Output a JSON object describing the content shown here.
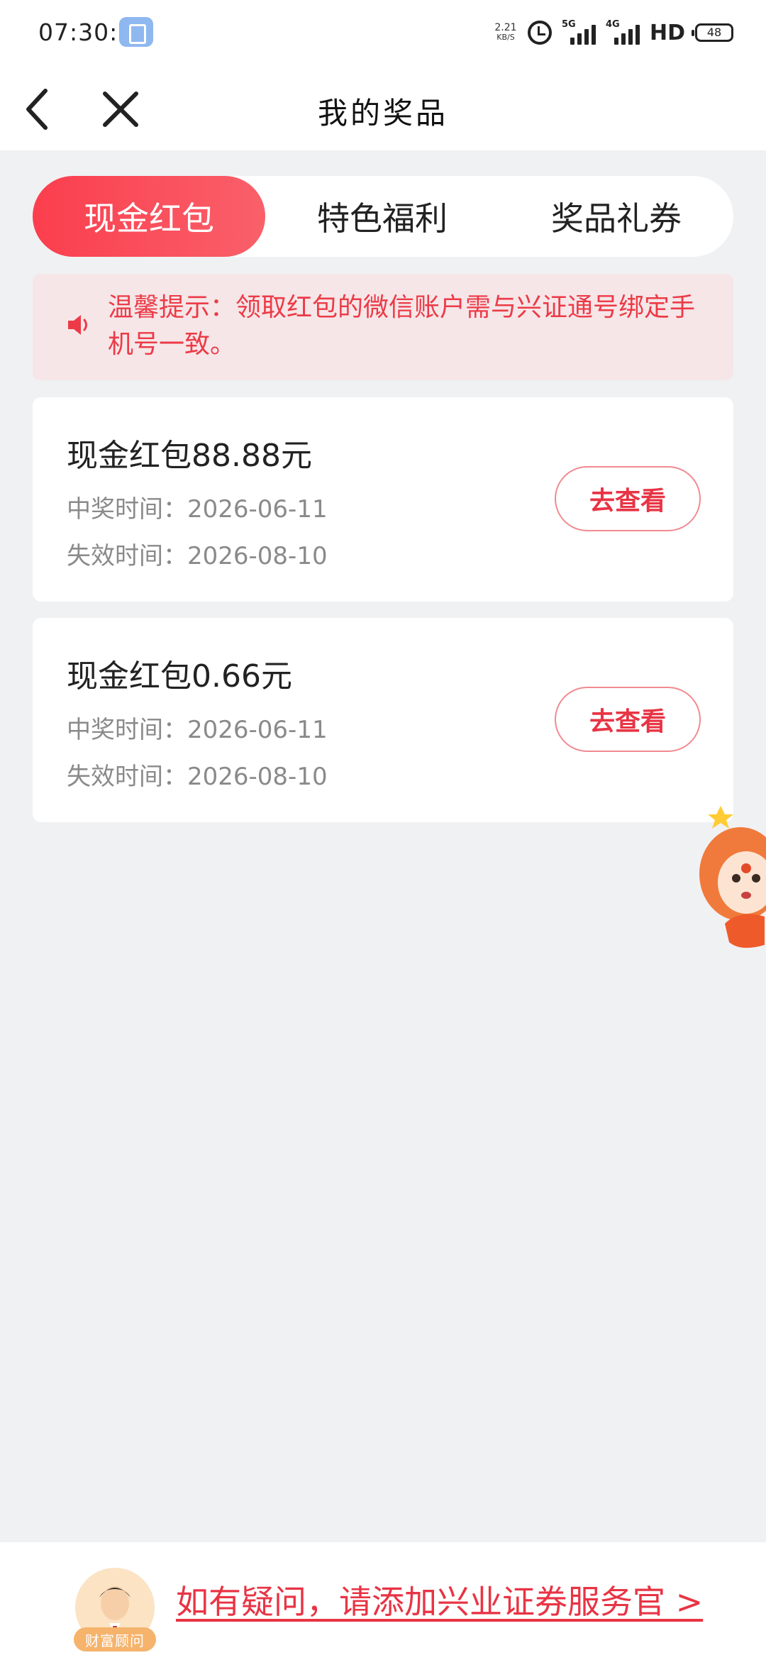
{
  "status_bar": {
    "time": "07:30:01",
    "net_speed_value": "2.21",
    "net_speed_unit": "KB/S",
    "signal1_tag": "5G",
    "signal2_tag": "4G",
    "hd_label": "HD",
    "battery": "48"
  },
  "header": {
    "title": "我的奖品"
  },
  "tabs": [
    {
      "label": "现金红包",
      "active": true
    },
    {
      "label": "特色福利",
      "active": false
    },
    {
      "label": "奖品礼券",
      "active": false
    }
  ],
  "notice": {
    "text": "温馨提示：领取红包的微信账户需与兴证通号绑定手机号一致。"
  },
  "prizes": [
    {
      "title": "现金红包88.88元",
      "win_time": "中奖时间：2026-06-11",
      "expire_time": "失效时间：2026-08-10",
      "button": "去查看"
    },
    {
      "title": "现金红包0.66元",
      "win_time": "中奖时间：2026-06-11",
      "expire_time": "失效时间：2026-08-10",
      "button": "去查看"
    }
  ],
  "bottom": {
    "advisor_badge": "财富顾问",
    "help_link": "如有疑问，请添加兴业证券服务官 >"
  },
  "colors": {
    "accent": "#fb3e4e",
    "notice_bg": "#f6e6e8",
    "page_bg": "#f0f1f3"
  }
}
